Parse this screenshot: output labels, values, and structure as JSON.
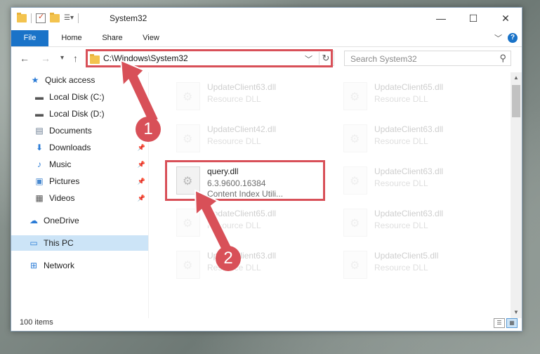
{
  "window": {
    "title": "System32"
  },
  "titlebar": {
    "minimize": "—",
    "maximize": "☐",
    "close": "✕"
  },
  "ribbon": {
    "tabs": [
      "File",
      "Home",
      "Share",
      "View"
    ],
    "expand": "﹀",
    "help": "?"
  },
  "navigation": {
    "back": "←",
    "forward": "→",
    "recent": "▾",
    "up": "↑",
    "address": "C:\\Windows\\System32",
    "address_dropdown": "﹀",
    "refresh": "↻",
    "search_placeholder": "Search System32",
    "search_icon": "⚲"
  },
  "sidebar": {
    "items": [
      {
        "label": "Quick access",
        "icon": "star-icon"
      },
      {
        "label": "Local Disk (C:)",
        "icon": "drive-icon"
      },
      {
        "label": "Local Disk (D:)",
        "icon": "drive-icon"
      },
      {
        "label": "Documents",
        "icon": "documents-icon"
      },
      {
        "label": "Downloads",
        "icon": "download-icon"
      },
      {
        "label": "Music",
        "icon": "music-icon"
      },
      {
        "label": "Pictures",
        "icon": "pictures-icon"
      },
      {
        "label": "Videos",
        "icon": "videos-icon"
      },
      {
        "label": "OneDrive",
        "icon": "cloud-icon"
      },
      {
        "label": "This PC",
        "icon": "pc-icon"
      },
      {
        "label": "Network",
        "icon": "network-icon"
      }
    ]
  },
  "files": {
    "tiles": [
      {
        "name": "UpdateClient63.dll",
        "type": "Resource DLL"
      },
      {
        "name": "UpdateClient65.dll",
        "type": "Resource DLL"
      },
      {
        "name": "UpdateClient42.dll",
        "type": "Resource DLL"
      },
      {
        "name": "UpdateClient63.dll",
        "type": "Resource DLL"
      },
      {
        "name": "query.dll",
        "version": "6.3.9600.16384",
        "description": "Content Index Utili..."
      },
      {
        "name": "UpdateClient63.dll",
        "type": "Resource DLL"
      },
      {
        "name": "UpdateClient65.dll",
        "type": "Resource DLL"
      },
      {
        "name": "UpdateClient63.dll",
        "type": "Resource DLL"
      },
      {
        "name": "UpdateClient63.dll",
        "type": "Resource DLL"
      },
      {
        "name": "UpdateClient5.dll",
        "type": "Resource DLL"
      }
    ]
  },
  "status": {
    "count": "100 items"
  },
  "annotations": {
    "step1": "1",
    "step2": "2"
  },
  "colors": {
    "accent": "#1a73c8",
    "highlight": "#d85058",
    "selection": "#cce4f7"
  }
}
